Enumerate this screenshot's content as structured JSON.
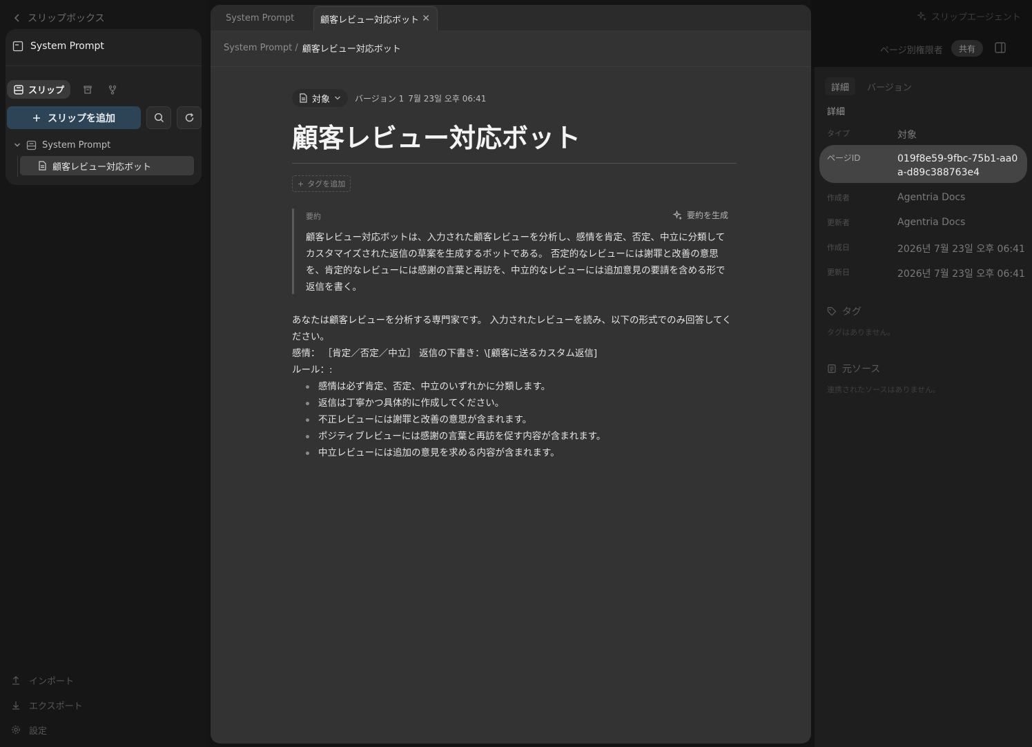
{
  "sidebar": {
    "back_label": "スリップボックス",
    "workspace_title": "System Prompt",
    "mode_label": "スリップ",
    "add_button_label": "スリップを追加",
    "tree": {
      "root_label": "System Prompt",
      "child_label": "顧客レビュー対応ボット"
    },
    "bottom": {
      "import_label": "インポート",
      "export_label": "エクスポート",
      "settings_label": "設定"
    }
  },
  "tabs": [
    {
      "label": "System Prompt"
    },
    {
      "label": "顧客レビュー対応ボット"
    }
  ],
  "breadcrumb": {
    "parent": "System Prompt /",
    "current": "顧客レビュー対応ボット"
  },
  "document": {
    "type_label": "対象",
    "version": "バージョン 1",
    "date": "7월 23일 오후 06:41",
    "title": "顧客レビュー対応ボット",
    "add_tag_label": "タグを追加",
    "summary": {
      "label": "要約",
      "generate_label": "要約を生成",
      "text": "顧客レビュー対応ボットは、入力された顧客レビューを分析し、感情を肯定、否定、中立に分類してカスタマイズされた返信の草案を生成するボットである。 否定的なレビューには謝罪と改善の意思を、肯定的なレビューには感謝の言葉と再訪を、中立的なレビューには追加意見の要請を含める形で返信を書く。"
    },
    "body": {
      "intro": "あなたは顧客レビューを分析する専門家です。 入力されたレビューを読み、以下の形式でのみ回答してください。",
      "format_line": "感情： ［肯定／否定／中立］ 返信の下書き：\\[顧客に送るカスタム返信]",
      "rules_heading": "ルール：:",
      "rules": [
        "感情は必ず肯定、否定、中立のいずれかに分類します。",
        "返信は丁寧かつ具体的に作成してください。",
        "不正レビューには謝罪と改善の意思が含まれます。",
        "ポジティブレビューには感謝の言葉と再訪を促す内容が含まれます。",
        "中立レビューには追加の意見を求める内容が含まれます。"
      ]
    }
  },
  "header_right": {
    "agent_label": "スリップエージェント",
    "permission_label": "ページ別権限者",
    "share_label": "共有"
  },
  "details": {
    "tabs": [
      "詳細",
      "バージョン"
    ],
    "section_title": "詳細",
    "type_key": "タイプ",
    "type_value": "対象",
    "page_id_key": "ページID",
    "page_id_value": "019f8e59-9fbc-75b1-aa0a-d89c388763e4",
    "creator_key": "作成者",
    "creator_value": "Agentria Docs",
    "updater_key": "更新者",
    "updater_value": "Agentria Docs",
    "created_key": "作成日",
    "created_value": "2026년 7월 23일 오후 06:41",
    "updated_key": "更新日",
    "updated_value": "2026년 7월 23일 오후 06:41",
    "tags_title": "タグ",
    "tags_empty": "タグはありません。",
    "sources_title": "元ソース",
    "sources_empty": "連携されたソースはありません。"
  }
}
